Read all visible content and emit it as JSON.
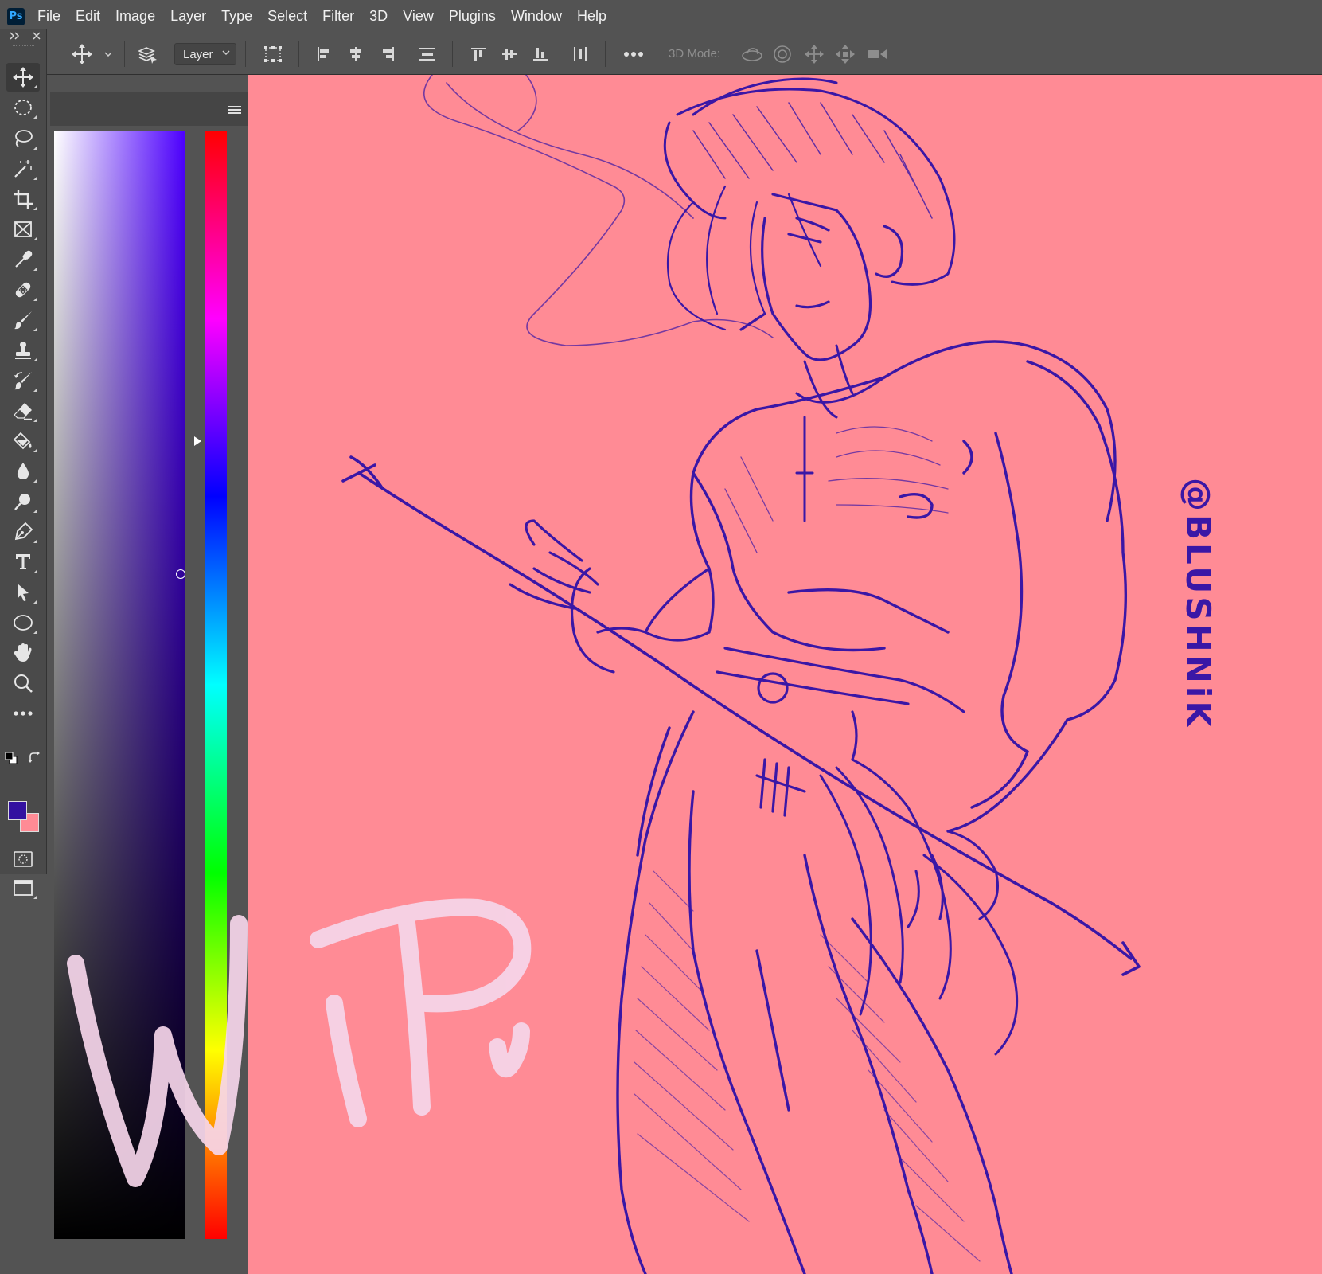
{
  "app": {
    "logo_text": "Ps"
  },
  "menu": {
    "items": [
      "File",
      "Edit",
      "Image",
      "Layer",
      "Type",
      "Select",
      "Filter",
      "3D",
      "View",
      "Plugins",
      "Window",
      "Help"
    ]
  },
  "options": {
    "auto_select_target": "Layer",
    "mode3d_label": "3D Mode:"
  },
  "toolbar": {
    "tools": [
      {
        "name": "move-tool",
        "icon": "move-icon",
        "active": true
      },
      {
        "name": "elliptical-marquee-tool",
        "icon": "marquee-icon"
      },
      {
        "name": "lasso-tool",
        "icon": "lasso-icon"
      },
      {
        "name": "magic-wand-tool",
        "icon": "magic-wand-icon"
      },
      {
        "name": "crop-tool",
        "icon": "crop-icon"
      },
      {
        "name": "frame-tool",
        "icon": "frame-icon"
      },
      {
        "name": "eyedropper-tool",
        "icon": "eyedropper-icon"
      },
      {
        "name": "healing-brush-tool",
        "icon": "bandage-icon"
      },
      {
        "name": "brush-tool",
        "icon": "brush-icon"
      },
      {
        "name": "clone-stamp-tool",
        "icon": "stamp-icon"
      },
      {
        "name": "history-brush-tool",
        "icon": "history-brush-icon"
      },
      {
        "name": "eraser-tool",
        "icon": "eraser-icon"
      },
      {
        "name": "paint-bucket-tool",
        "icon": "paint-bucket-icon"
      },
      {
        "name": "blur-tool",
        "icon": "blur-drop-icon"
      },
      {
        "name": "dodge-tool",
        "icon": "dodge-icon"
      },
      {
        "name": "pen-tool",
        "icon": "pen-icon"
      },
      {
        "name": "type-tool",
        "icon": "type-icon"
      },
      {
        "name": "path-selection-tool",
        "icon": "arrow-icon"
      },
      {
        "name": "ellipse-tool",
        "icon": "ellipse-icon"
      },
      {
        "name": "hand-tool",
        "icon": "hand-icon"
      },
      {
        "name": "zoom-tool",
        "icon": "zoom-icon"
      },
      {
        "name": "edit-toolbar",
        "icon": "more-icon"
      }
    ]
  },
  "colors": {
    "foreground": "#3311a0",
    "background": "#ff8b95",
    "canvas": "#ff8b95",
    "sketch_ink": "#3a17a6",
    "wip_paint": "#f6d6ea"
  },
  "color_panel": {
    "hue_fraction": 0.28,
    "saturation": 0.97,
    "brightness": 0.6
  },
  "artwork": {
    "overlay_text": "WiP",
    "signature": "@BLUSHNiK"
  }
}
